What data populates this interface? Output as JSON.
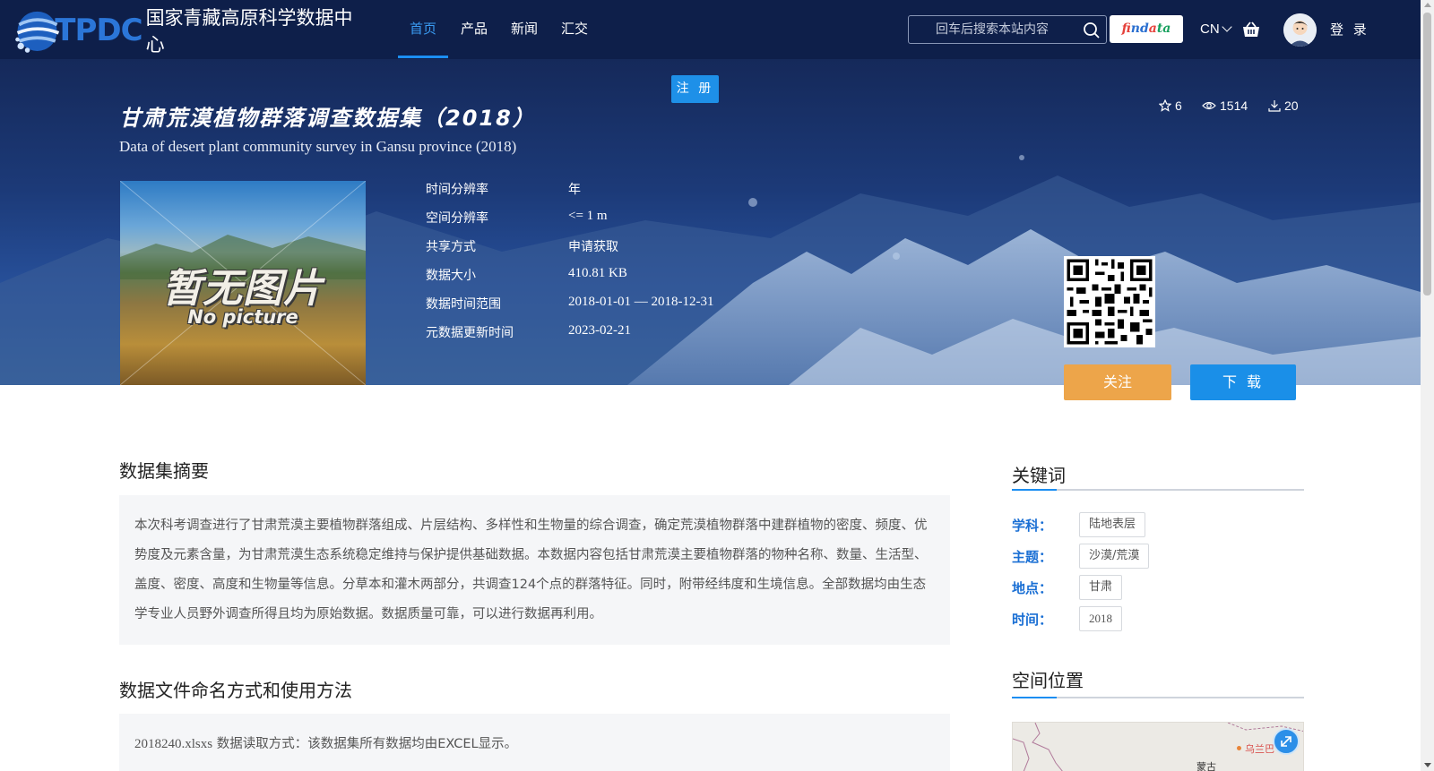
{
  "header": {
    "logo_text": "TPDC",
    "logo_name": "国家青藏高原科学数据中心",
    "nav": [
      {
        "label": "首页",
        "active": true
      },
      {
        "label": "产品",
        "active": false
      },
      {
        "label": "新闻",
        "active": false
      },
      {
        "label": "汇交",
        "active": false
      }
    ],
    "search": {
      "placeholder": "回车后搜索本站内容",
      "value": ""
    },
    "findata": {
      "part1": "f",
      "part2": "ind",
      "part3": "a",
      "part4": "ta"
    },
    "lang": "CN",
    "login": "登 录",
    "icons": {
      "search": "search-icon",
      "cart": "cart-icon",
      "avatar": "user-avatar"
    }
  },
  "banner": {
    "register": "注 册",
    "title_cn": "甘肃荒漠植物群落调查数据集（2018）",
    "title_en": "Data of desert plant community survey in Gansu province (2018)",
    "stats": {
      "stars": "6",
      "views": "1514",
      "downloads": "20"
    },
    "thumbnail": {
      "big": "暂无图片",
      "small": "No picture"
    },
    "meta": [
      {
        "label": "时间分辨率",
        "value": "年"
      },
      {
        "label": "空间分辨率",
        "value": "<= 1 m"
      },
      {
        "label": "共享方式",
        "value": "申请获取"
      },
      {
        "label": "数据大小",
        "value": "410.81 KB"
      },
      {
        "label": "数据时间范围",
        "value": "2018-01-01 — 2018-12-31"
      },
      {
        "label": "元数据更新时间",
        "value": "2023-02-21"
      }
    ],
    "follow": "关注",
    "download": "下 载"
  },
  "main": {
    "abstract_title": "数据集摘要",
    "abstract_text": "本次科考调查进行了甘肃荒漠主要植物群落组成、片层结构、多样性和生物量的综合调查，确定荒漠植物群落中建群植物的密度、频度、优势度及元素含量，为甘肃荒漠生态系统稳定维持与保护提供基础数据。本数据内容包括甘肃荒漠主要植物群落的物种名称、数量、生活型、盖度、密度、高度和生物量等信息。分草本和灌木两部分，共调查124个点的群落特征。同时，附带经纬度和生境信息。全部数据均由生态学专业人员野外调查所得且均为原始数据。数据质量可靠，可以进行数据再利用。",
    "file_title": "数据文件命名方式和使用方法",
    "file_name": "2018240.xlsxs",
    "file_text": " 数据读取方式：该数据集所有数据均由EXCEL显示。"
  },
  "sidebar": {
    "keywords_title": "关键词",
    "keywords": [
      {
        "label": "学科：",
        "tag": "陆地表层"
      },
      {
        "label": "主题：",
        "tag": "沙漠/荒漠"
      },
      {
        "label": "地点：",
        "tag": "甘肃"
      },
      {
        "label": "时间：",
        "tag": "2018"
      }
    ],
    "location_title": "空间位置",
    "map_labels": {
      "city": "乌兰巴",
      "region": "蒙古"
    }
  },
  "colors": {
    "navbar": "#0e1f4a",
    "accent_blue": "#1b8ef2",
    "follow_orange": "#eda54a",
    "keyword_label": "#1a6fd4"
  }
}
